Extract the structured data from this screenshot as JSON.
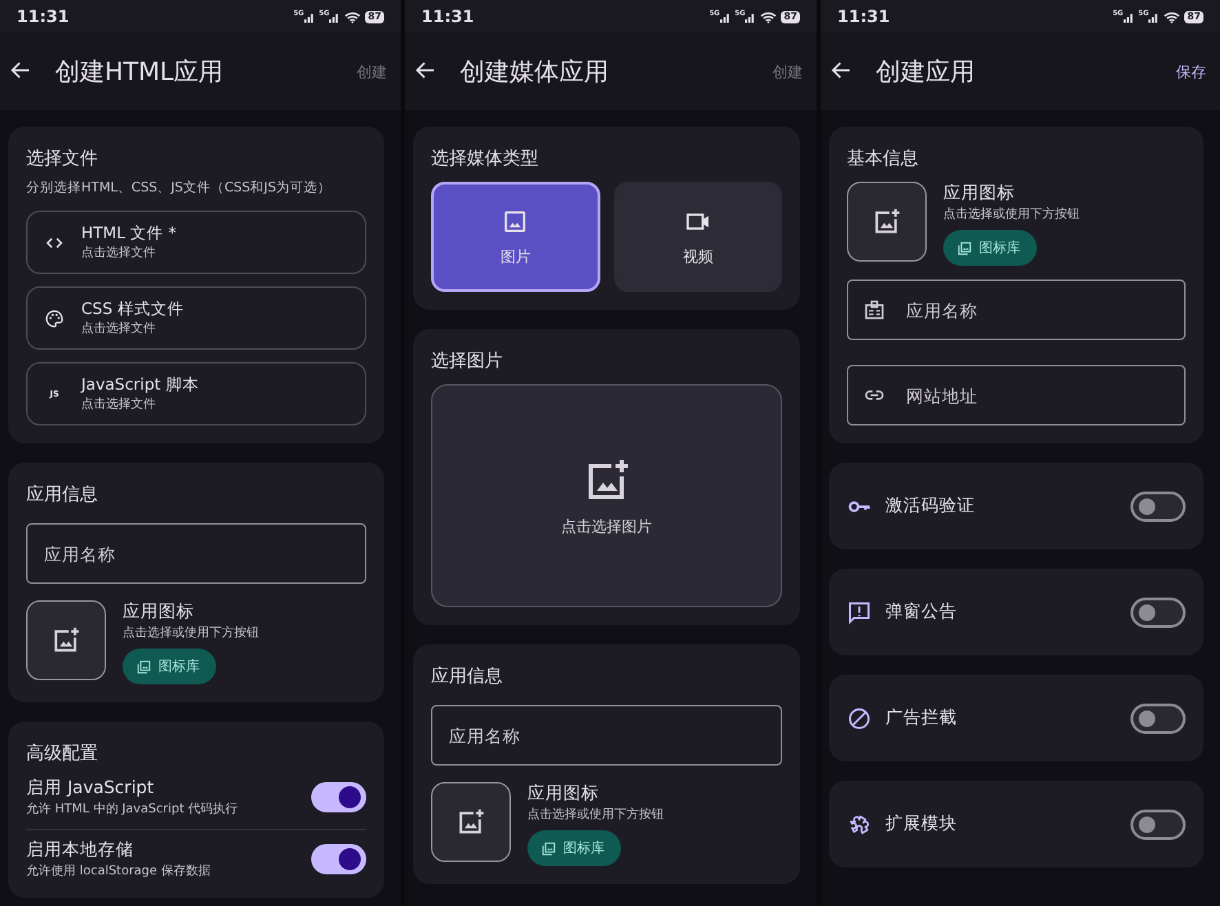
{
  "screens": [
    {
      "status_bar": {
        "time": "11:31",
        "network_labels": [
          "5G",
          "5G"
        ],
        "battery": "87"
      },
      "app_bar": {
        "title": "创建HTML应用",
        "action": "创建",
        "action_disabled": true
      },
      "sections": [
        {
          "kind": "files",
          "title": "选择文件",
          "subtitle": "分别选择HTML、CSS、JS文件（CSS和JS为可选）",
          "items": [
            {
              "label": "HTML 文件 *",
              "hint": "点击选择文件"
            },
            {
              "label": "CSS 样式文件",
              "hint": "点击选择文件"
            },
            {
              "icon_text": "JS",
              "label": "JavaScript 脚本",
              "hint": "点击选择文件"
            }
          ]
        },
        {
          "kind": "app_info",
          "title": "应用信息",
          "name_field": {
            "placeholder": "应用名称"
          },
          "icon_picker": {
            "label": "应用图标",
            "hint": "点击选择或使用下方按钮",
            "button": "图标库"
          }
        },
        {
          "kind": "switches",
          "title": "高级配置",
          "items": [
            {
              "label": "启用 JavaScript",
              "description": "允许 HTML 中的 JavaScript 代码执行",
              "on": true
            },
            {
              "label": "启用本地存储",
              "description": "允许使用 localStorage 保存数据",
              "on": true
            }
          ]
        }
      ]
    },
    {
      "status_bar": {
        "time": "11:31",
        "network_labels": [
          "5G",
          "5G"
        ],
        "battery": "87"
      },
      "app_bar": {
        "title": "创建媒体应用",
        "action": "创建",
        "action_disabled": true
      },
      "sections": [
        {
          "kind": "media_type",
          "title": "选择媒体类型",
          "options": [
            {
              "label": "图片",
              "selected": true
            },
            {
              "label": "视频",
              "selected": false
            }
          ]
        },
        {
          "kind": "image_picker",
          "title": "选择图片",
          "hint": "点击选择图片"
        },
        {
          "kind": "app_info",
          "title": "应用信息",
          "name_field": {
            "placeholder": "应用名称"
          },
          "icon_picker": {
            "label": "应用图标",
            "hint": "点击选择或使用下方按钮",
            "button": "图标库"
          }
        }
      ]
    },
    {
      "status_bar": {
        "time": "11:31",
        "network_labels": [
          "5G",
          "5G"
        ],
        "battery": "87"
      },
      "app_bar": {
        "title": "创建应用",
        "action": "保存",
        "action_disabled": false
      },
      "sections": [
        {
          "kind": "basic_info",
          "title": "基本信息",
          "icon_picker": {
            "label": "应用图标",
            "hint": "点击选择或使用下方按钮",
            "button": "图标库"
          },
          "fields": [
            {
              "placeholder": "应用名称"
            },
            {
              "placeholder": "网站地址"
            }
          ]
        },
        {
          "kind": "toggle",
          "label": "激活码验证",
          "on": false
        },
        {
          "kind": "toggle",
          "label": "弹窗公告",
          "on": false
        },
        {
          "kind": "toggle",
          "label": "广告拦截",
          "on": false
        },
        {
          "kind": "toggle",
          "label": "扩展模块",
          "on": false
        }
      ]
    }
  ]
}
